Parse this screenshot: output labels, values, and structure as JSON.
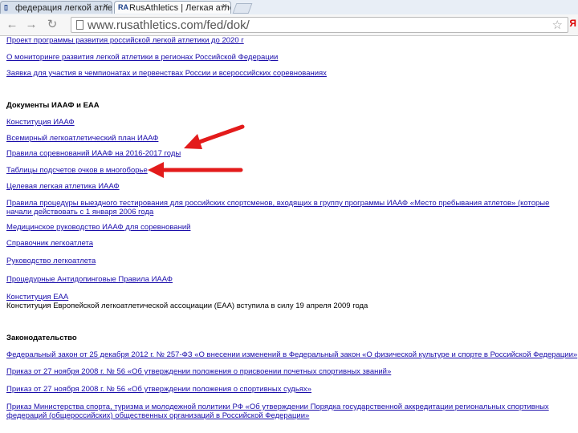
{
  "browser": {
    "tabs": [
      {
        "title": "федерация легкой атлетик",
        "active": false,
        "favicon": "page-icon"
      },
      {
        "title": "RusAthletics | Легкая атлет",
        "active": true,
        "favicon": "rusathletics-logo-icon",
        "favicon_text": "RA"
      }
    ],
    "address": "www.rusathletics.com/fed/dok/",
    "search_badge": "Я"
  },
  "content": {
    "top_links": [
      "Проект программы развития российской легкой атлетики до 2020 г",
      "О мониторинге развития легкой атлетики в регионах Российской Федерации",
      "Заявка для участия в чемпионатах и первенствах России и всероссийских соревнованиях"
    ],
    "iaaf_heading": "Документы ИААФ и ЕАА",
    "iaaf_links": [
      "Конституция ИААФ",
      "Всемирный легкоатлетический план ИААФ",
      "Правила соревнований ИААФ на 2016-2017 годы",
      "Таблицы подсчетов очков в многоборье",
      "Целевая легкая атлетика ИААФ",
      "Правила процедуры выездного тестирования для российских спортсменов, входящих в группу программы ИААФ «Место пребывания атлетов» (которые начали действовать с 1 января 2006 года",
      "Медицинское руководство ИААФ для соревнований",
      "Справочник легкоатлета",
      "Руководство легкоатлета",
      "Процедурные Антидопинговые Правила ИААФ",
      "Конституция ЕАА"
    ],
    "eaa_note": "Конституция Европейской легкоатлетической ассоциации (ЕАА) вступила в силу 19 апреля 2009 года",
    "law_heading": "Законодательство",
    "law_links": [
      "Федеральный закон от 25 декабря 2012 г. № 257-ФЗ «О внесении изменений в Федеральный закон «О физической культуре и спорте в Российской Федерации»",
      "Приказ от 27 ноября 2008 г. № 56 «Об утверждении положения о присвоении почетных спортивных званий»",
      "Приказ от 27 ноября 2008 г. № 56 «Об утверждении положения о спортивных судьях»",
      "Приказ Министерства спорта, туризма и молодежной политики РФ «Об утверждении Порядка государственной аккредитации региональных спортивных федераций (общероссийских) общественных организаций в Российской Федерации»"
    ],
    "arrow_color": "#e31b1b"
  }
}
